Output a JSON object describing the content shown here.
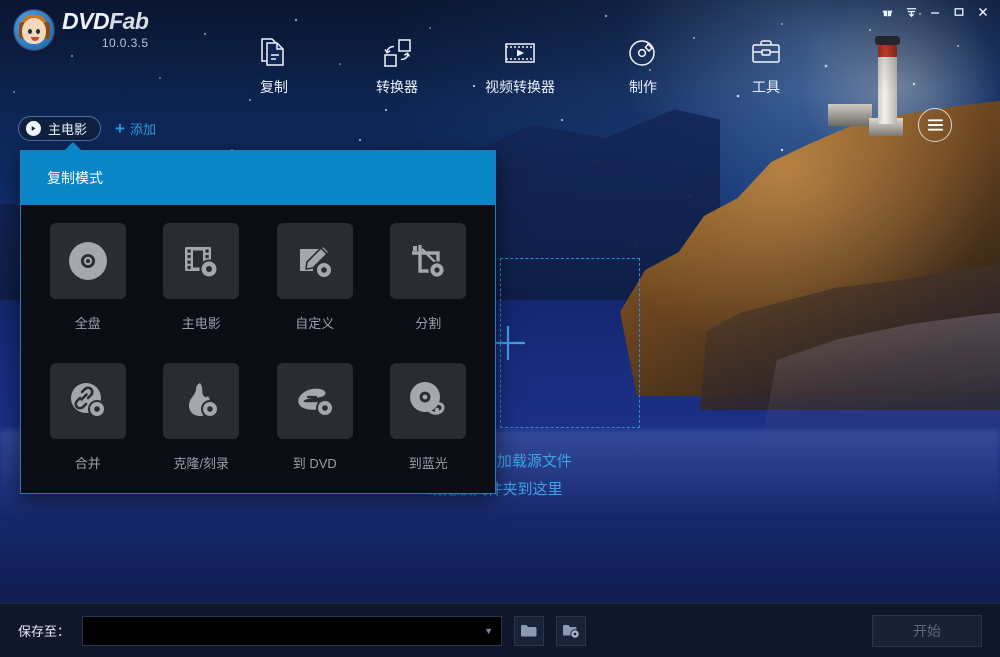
{
  "app": {
    "name": "DVDFab",
    "name_part1": "DVD",
    "name_part2": "Fab",
    "version": "10.0.3.5",
    "logo_icon": "dvdfab-monkey-logo-icon"
  },
  "titlebar": {
    "buttons": [
      {
        "name": "gift-icon",
        "glyph": "▼"
      },
      {
        "name": "download-icon",
        "glyph": "▼"
      },
      {
        "name": "minimize-icon",
        "glyph": "—"
      },
      {
        "name": "maximize-icon",
        "glyph": "□"
      },
      {
        "name": "close-icon",
        "glyph": "✕"
      }
    ]
  },
  "nav": {
    "items": [
      {
        "label": "复制",
        "icon": "copy-document-icon"
      },
      {
        "label": "转换器",
        "icon": "converter-icon"
      },
      {
        "label": "视频转换器",
        "icon": "video-converter-icon"
      },
      {
        "label": "制作",
        "icon": "creator-disc-icon"
      },
      {
        "label": "工具",
        "icon": "toolkit-icon"
      }
    ],
    "active_index": 0
  },
  "tabs": {
    "active_tab_label": "主电影",
    "add_label": "添加",
    "add_plus": "+"
  },
  "panel": {
    "title": "复制模式",
    "modes": [
      {
        "label": "全盘",
        "icon": "full-disc-icon"
      },
      {
        "label": "主电影",
        "icon": "main-movie-icon"
      },
      {
        "label": "自定义",
        "icon": "customize-pencil-icon"
      },
      {
        "label": "分割",
        "icon": "split-crop-icon"
      },
      {
        "label": "合并",
        "icon": "merge-link-icon"
      },
      {
        "label": "克隆/刻录",
        "icon": "clone-burn-flame-icon"
      },
      {
        "label": "到 DVD",
        "icon": "to-dvd-icon"
      },
      {
        "label": "到蓝光",
        "icon": "to-bluray-icon"
      }
    ]
  },
  "dropzone": {
    "line1": "点击“+”按钮加载源文件",
    "line2": "或拖放文件夹到这里",
    "plus_icon": "plus-icon"
  },
  "menu_button": {
    "icon": "hamburger-menu-icon"
  },
  "bottombar": {
    "save_to_label": "保存至：",
    "save_to_value": "",
    "save_to_placeholder": "",
    "browse_folder_icon": "folder-icon",
    "disc_folder_icon": "disc-folder-icon",
    "start_label": "开始",
    "start_enabled": false
  },
  "colors": {
    "accent_blue": "#0a86c6",
    "link_blue": "#2e9bdc",
    "panel_bg": "#0c0c14",
    "tile_bg": "#2b2b34",
    "bottom_bar": "#10172b"
  }
}
